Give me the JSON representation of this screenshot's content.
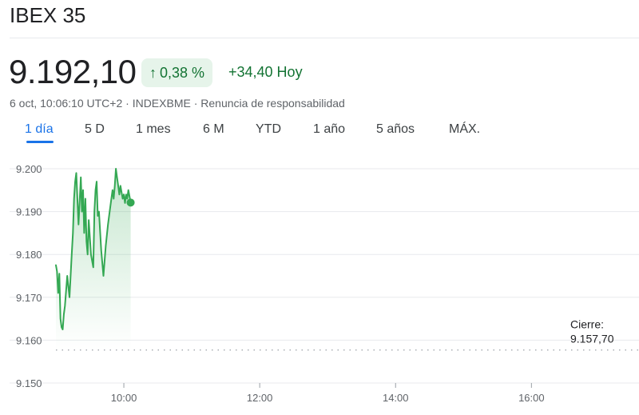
{
  "header": {
    "title": "IBEX 35",
    "price": "9.192,10",
    "change_percent": "0,38 %",
    "change_arrow": "↑",
    "change_value": "+34,40 Hoy",
    "meta": "6 oct, 10:06:10 UTC+2 · INDEXBME · Renuncia de responsabilidad"
  },
  "tabs": [
    {
      "label": "1 día",
      "active": true
    },
    {
      "label": "5 D"
    },
    {
      "label": "1 mes"
    },
    {
      "label": "6 M"
    },
    {
      "label": "YTD"
    },
    {
      "label": "1 año"
    },
    {
      "label": "5 años"
    },
    {
      "label": "MÁX."
    }
  ],
  "colors": {
    "positive": "#137333",
    "line": "#34a853",
    "accent": "#1a73e8"
  },
  "chart_data": {
    "type": "area",
    "y_ticks": [
      "9.200",
      "9.190",
      "9.180",
      "9.170",
      "9.160",
      "9.150"
    ],
    "x_ticks": [
      "10:00",
      "12:00",
      "14:00",
      "16:00"
    ],
    "ylim": [
      9150,
      9200
    ],
    "xlim": [
      "09:00",
      "17:35"
    ],
    "reference": {
      "label_line1": "Cierre:",
      "label_line2": "9.157,70",
      "value": 9157.7
    },
    "series": [
      {
        "x": [
          "09:00",
          "09:01",
          "09:02",
          "09:03",
          "09:04",
          "09:05",
          "09:06",
          "09:07",
          "09:08",
          "09:10",
          "09:12",
          "09:14",
          "09:15",
          "09:16",
          "09:17",
          "09:18",
          "09:20",
          "09:22",
          "09:23",
          "09:24",
          "09:25",
          "09:26",
          "09:27",
          "09:28",
          "09:29",
          "09:31",
          "09:33",
          "09:34",
          "09:35",
          "09:36",
          "09:37",
          "09:38",
          "09:40",
          "09:42",
          "09:44",
          "09:46",
          "09:48",
          "09:50",
          "09:51",
          "09:52",
          "09:53",
          "09:54",
          "09:55",
          "09:56",
          "09:57",
          "09:59",
          "10:00",
          "10:01",
          "10:02",
          "10:03",
          "10:04",
          "10:06"
        ],
        "y": [
          9177.5,
          9176,
          9171,
          9175.5,
          9165,
          9163,
          9162.5,
          9166,
          9168,
          9175,
          9170,
          9180,
          9185,
          9193,
          9197,
          9199,
          9187,
          9198,
          9190,
          9195,
          9185,
          9193,
          9183,
          9180,
          9188,
          9180,
          9177,
          9190,
          9195,
          9197,
          9189,
          9190,
          9181,
          9175,
          9182,
          9187,
          9191,
          9195,
          9193,
          9196,
          9200,
          9198,
          9196,
          9194,
          9196,
          9193,
          9194,
          9192,
          9194,
          9193,
          9195,
          9192.1
        ]
      }
    ]
  }
}
